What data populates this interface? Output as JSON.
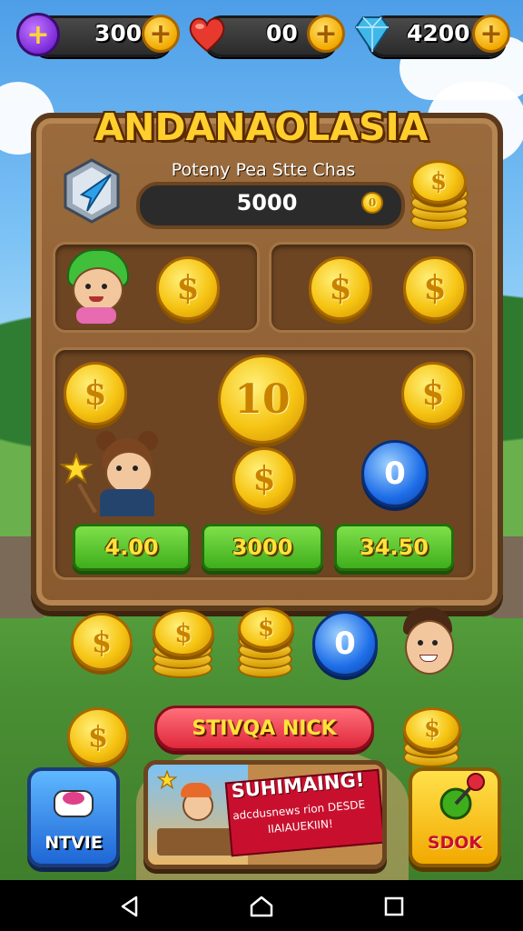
{
  "hud": {
    "add_button_glyph": "+",
    "coins": "300",
    "lives": "00",
    "gems": "4200"
  },
  "panel": {
    "title": "ANDANAOLASIA",
    "subtitle": "Poteny Pea Stte Chas",
    "score": "5000",
    "score_badge": "0"
  },
  "coins": {
    "symbol": "$",
    "big_value": "10",
    "blue_value": "0"
  },
  "buttons": {
    "price_1": "4.00",
    "price_2": "3000",
    "price_3": "34.50",
    "red_action": "STIVQA NICK",
    "left_button": "NTVIE",
    "right_button": "SDOK"
  },
  "banner": {
    "title": "SUHIMAING!",
    "subtitle": "adcdusnews rion DESDE IIAIAUEKIIN!"
  },
  "icons": {
    "heart": "heart-icon",
    "gem": "diamond-icon",
    "compass": "compass-icon",
    "nav_back": "back-icon",
    "nav_home": "home-icon",
    "nav_recent": "recent-apps-icon"
  },
  "colors": {
    "wood": "#8a5a2f",
    "gold": "#f6c413",
    "green_button": "#3fae1c",
    "red_button": "#e0283b",
    "blue_coin": "#1e6ee8"
  }
}
